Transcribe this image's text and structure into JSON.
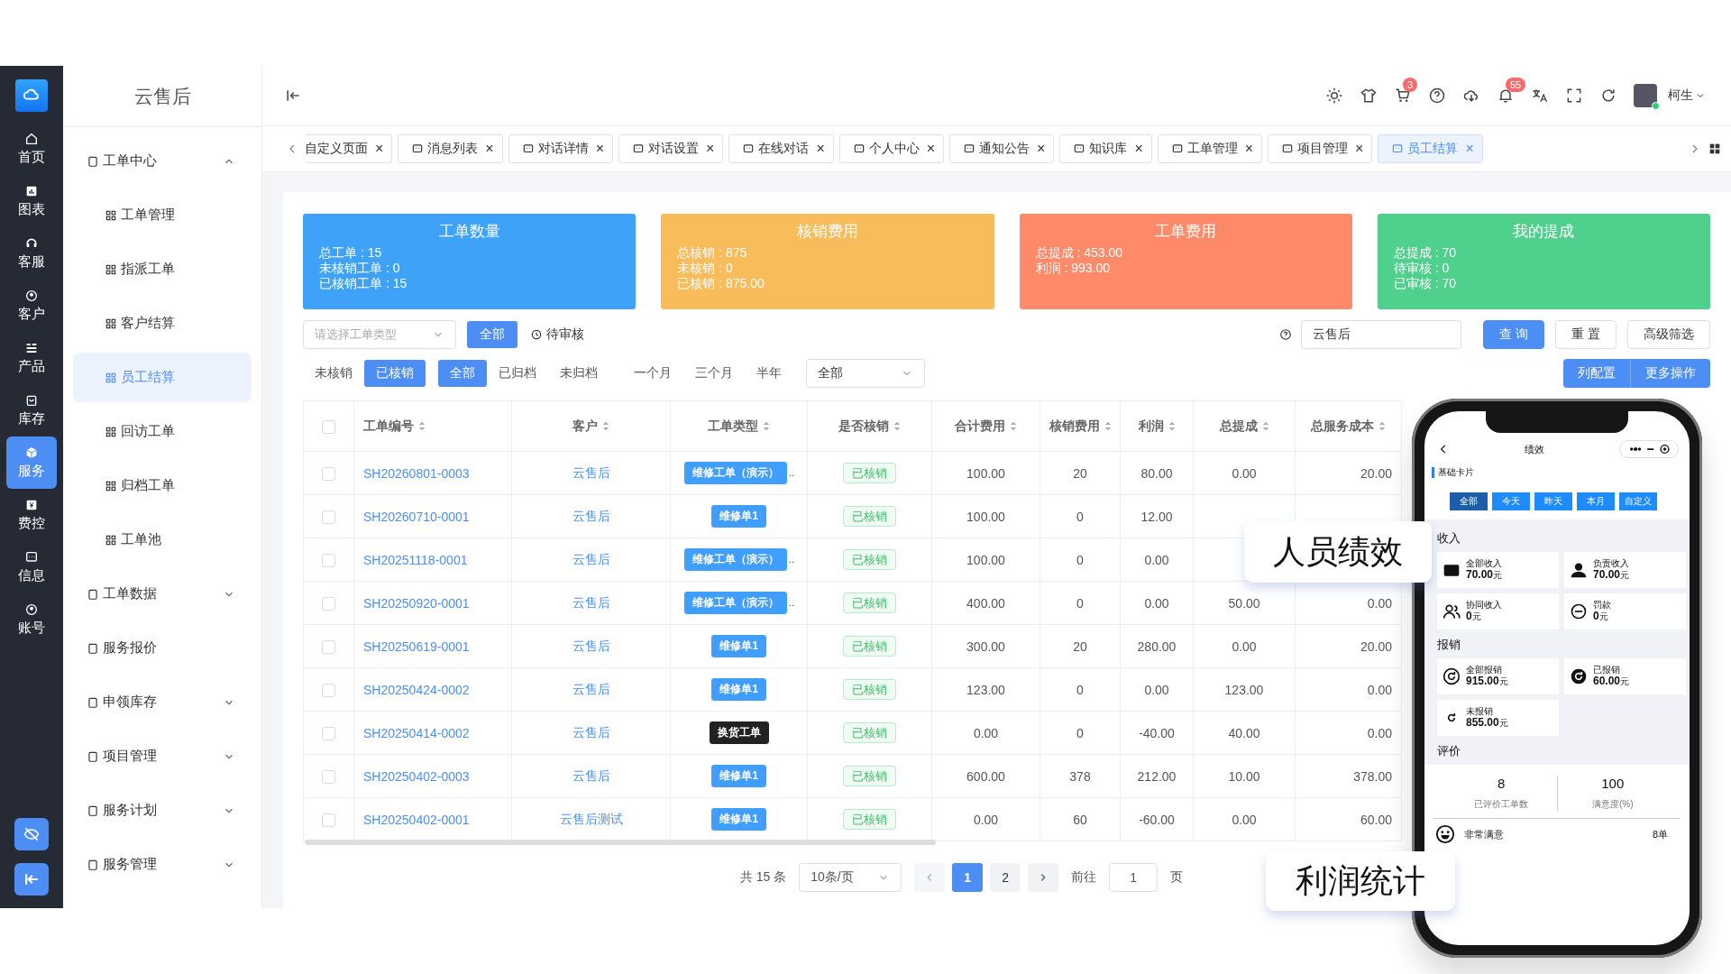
{
  "rail": {
    "items": [
      {
        "label": "首页",
        "selected": false
      },
      {
        "label": "图表",
        "selected": false
      },
      {
        "label": "客服",
        "selected": false
      },
      {
        "label": "客户",
        "selected": false
      },
      {
        "label": "产品",
        "selected": false
      },
      {
        "label": "库存",
        "selected": false
      },
      {
        "label": "服务",
        "selected": true
      },
      {
        "label": "费控",
        "selected": false
      },
      {
        "label": "信息",
        "selected": false
      },
      {
        "label": "账号",
        "selected": false
      }
    ]
  },
  "menu": {
    "title": "云售后",
    "items": [
      {
        "kind": "group",
        "label": "工单中心",
        "expanded": true,
        "children": [
          {
            "label": "工单管理",
            "selected": false
          },
          {
            "label": "指派工单",
            "selected": false
          },
          {
            "label": "客户结算",
            "selected": false
          },
          {
            "label": "员工结算",
            "selected": true
          },
          {
            "label": "回访工单",
            "selected": false
          },
          {
            "label": "归档工单",
            "selected": false
          },
          {
            "label": "工单池",
            "selected": false
          }
        ]
      },
      {
        "kind": "group",
        "label": "工单数据",
        "expanded": false
      },
      {
        "kind": "link",
        "label": "服务报价"
      },
      {
        "kind": "group",
        "label": "申领库存",
        "expanded": false
      },
      {
        "kind": "group",
        "label": "项目管理",
        "expanded": false
      },
      {
        "kind": "group",
        "label": "服务计划",
        "expanded": false
      },
      {
        "kind": "group",
        "label": "服务管理",
        "expanded": false
      }
    ]
  },
  "header": {
    "cart_badge": "3",
    "bell_badge": "55",
    "user": "柯生"
  },
  "tabs": [
    {
      "label": "自定义页面",
      "selected": false,
      "close": "×"
    },
    {
      "label": "消息列表",
      "selected": false,
      "close": "×"
    },
    {
      "label": "对话详情",
      "selected": false,
      "close": "×"
    },
    {
      "label": "对话设置",
      "selected": false,
      "close": "×"
    },
    {
      "label": "在线对话",
      "selected": false,
      "close": "×"
    },
    {
      "label": "个人中心",
      "selected": false,
      "close": "×"
    },
    {
      "label": "通知公告",
      "selected": false,
      "close": "×"
    },
    {
      "label": "知识库",
      "selected": false,
      "close": "×"
    },
    {
      "label": "工单管理",
      "selected": false,
      "close": "×"
    },
    {
      "label": "项目管理",
      "selected": false,
      "close": "×"
    },
    {
      "label": "员工结算",
      "selected": true,
      "close": "×"
    }
  ],
  "stats": [
    {
      "title": "工单数量",
      "color": "#3ea3f8",
      "lines": [
        "总工单 : 15",
        "未核销工单 : 0",
        "已核销工单 : 15"
      ]
    },
    {
      "title": "核销费用",
      "color": "#f9bc5b",
      "lines": [
        "总核销 : 875",
        "未核销 : 0",
        "已核销 : 875.00"
      ]
    },
    {
      "title": "工单费用",
      "color": "#fe8a6a",
      "lines": [
        "总提成 : 453.00",
        "利润 : 993.00"
      ]
    },
    {
      "title": "我的提成",
      "color": "#4fd08c",
      "lines": [
        "总提成 : 70",
        "待审核 : 0",
        "已审核 : 70"
      ]
    }
  ],
  "filters": {
    "type_select": {
      "placeholder": "请选择工单类型"
    },
    "review": [
      {
        "label": "全部",
        "selected": true
      },
      {
        "label": "待审核",
        "selected": false
      }
    ],
    "search": {
      "value": "云售后"
    },
    "buttons": [
      "查 询",
      "重 置",
      "高级筛选"
    ]
  },
  "toggles": {
    "writeoff": [
      {
        "label": "未核销",
        "selected": false
      },
      {
        "label": "已核销",
        "selected": true
      }
    ],
    "archive": [
      {
        "label": "全部",
        "selected": true
      },
      {
        "label": "已归档",
        "selected": false
      },
      {
        "label": "未归档",
        "selected": false
      }
    ],
    "period": [
      {
        "label": "一个月",
        "selected": false
      },
      {
        "label": "三个月",
        "selected": false
      },
      {
        "label": "半年",
        "selected": false
      }
    ],
    "range_select": {
      "value": "全部"
    },
    "actions": [
      "列配置",
      "更多操作"
    ]
  },
  "table": {
    "select_all": {
      "checked": false
    },
    "columns": [
      "工单编号",
      "客户",
      "工单类型",
      "是否核销",
      "合计费用",
      "核销费用",
      "利润",
      "总提成",
      "总服务成本"
    ],
    "rows": [
      {
        "checked": false,
        "id": "SH20260801-0003",
        "customer": "云售后",
        "type": "维修工单（演示）",
        "kind": "repair",
        "type_more": "‥",
        "status": "已核销",
        "total": "100.00",
        "writeoff": "20",
        "profit": "80.00",
        "commission": "0.00",
        "cost": "20.00"
      },
      {
        "checked": false,
        "id": "SH20260710-0001",
        "customer": "云售后",
        "type": "维修单1",
        "kind": "repair",
        "status": "已核销",
        "total": "100.00",
        "writeoff": "0",
        "profit": "12.00"
      },
      {
        "checked": false,
        "id": "SH20251118-0001",
        "customer": "云售后",
        "type": "维修工单（演示）",
        "kind": "repair",
        "type_more": "‥",
        "status": "已核销",
        "total": "100.00",
        "writeoff": "0",
        "profit": "0.00"
      },
      {
        "checked": false,
        "id": "SH20250920-0001",
        "customer": "云售后",
        "type": "维修工单（演示）",
        "kind": "repair",
        "type_more": "‥",
        "status": "已核销",
        "total": "400.00",
        "writeoff": "0",
        "profit": "0.00",
        "commission": "50.00",
        "cost": "0.00"
      },
      {
        "checked": false,
        "id": "SH20250619-0001",
        "customer": "云售后",
        "type": "维修单1",
        "kind": "repair",
        "status": "已核销",
        "total": "300.00",
        "writeoff": "20",
        "profit": "280.00",
        "commission": "0.00",
        "cost": "20.00"
      },
      {
        "checked": false,
        "id": "SH20250424-0002",
        "customer": "云售后",
        "type": "维修单1",
        "kind": "repair",
        "status": "已核销",
        "total": "123.00",
        "writeoff": "0",
        "profit": "0.00",
        "commission": "123.00",
        "cost": "0.00"
      },
      {
        "checked": false,
        "id": "SH20250414-0002",
        "customer": "云售后",
        "type": "换货工单",
        "kind": "exchange",
        "status": "已核销",
        "total": "0.00",
        "writeoff": "0",
        "profit": "-40.00",
        "commission": "40.00",
        "cost": "0.00"
      },
      {
        "checked": false,
        "id": "SH20250402-0003",
        "customer": "云售后",
        "type": "维修单1",
        "kind": "repair",
        "status": "已核销",
        "total": "600.00",
        "writeoff": "378",
        "profit": "212.00",
        "commission": "10.00",
        "cost": "378.00"
      },
      {
        "checked": false,
        "id": "SH20250402-0001",
        "customer": "云售后测试",
        "type": "维修单1",
        "kind": "repair",
        "status": "已核销",
        "total": "0.00",
        "writeoff": "60",
        "profit": "-60.00",
        "commission": "0.00",
        "cost": "60.00"
      }
    ]
  },
  "pagination": {
    "total": "共 15 条",
    "page_size": "10条/页",
    "pages": [
      {
        "label": "1",
        "selected": true
      },
      {
        "label": "2",
        "selected": false
      }
    ],
    "goto_label": "前往",
    "goto_value": "1",
    "goto_unit": "页"
  },
  "callouts": [
    "人员绩效",
    "利润统计"
  ],
  "phone": {
    "title": "绩效",
    "section": "基础卡片",
    "ranges": [
      {
        "label": "全部",
        "selected": true
      },
      {
        "label": "今天",
        "selected": false
      },
      {
        "label": "昨天",
        "selected": false
      },
      {
        "label": "本月",
        "selected": false
      },
      {
        "label": "自定义",
        "selected": false
      }
    ],
    "income_title": "收入",
    "income": [
      {
        "label": "全部收入",
        "value": "70.00",
        "unit": "元"
      },
      {
        "label": "负责收入",
        "value": "70.00",
        "unit": "元"
      },
      {
        "label": "协同收入",
        "value": "0",
        "unit": "元"
      },
      {
        "label": "罚款",
        "value": "0",
        "unit": "元"
      }
    ],
    "expense_title": "报销",
    "expense": [
      {
        "label": "全部报销",
        "value": "915.00",
        "unit": "元"
      },
      {
        "label": "已报销",
        "value": "60.00",
        "unit": "元"
      },
      {
        "label": "未报销",
        "value": "855.00",
        "unit": "元"
      }
    ],
    "rating_title": "评价",
    "ratings": [
      {
        "value": "8",
        "label": "已评价工单数"
      },
      {
        "value": "100",
        "label": "满意度(%)"
      }
    ],
    "satisfaction": {
      "label": "非常满意",
      "count": "8单"
    }
  }
}
